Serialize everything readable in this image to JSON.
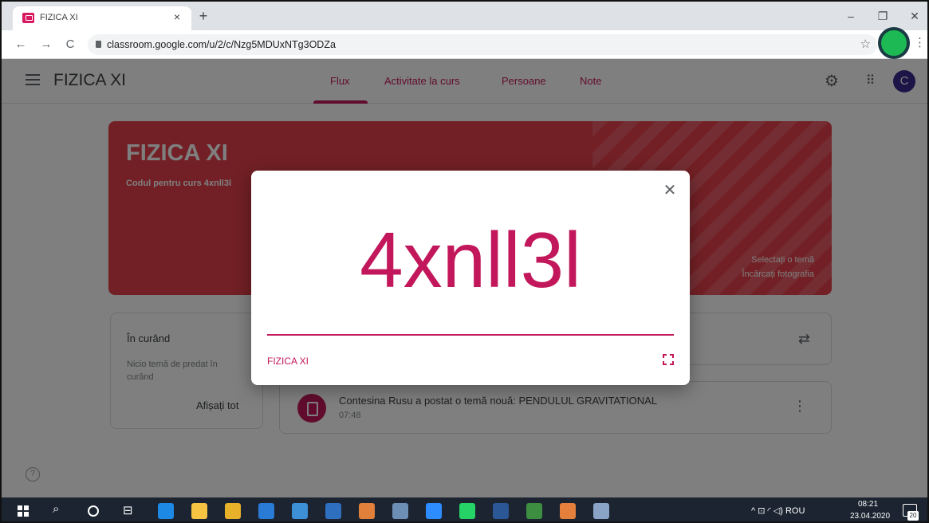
{
  "browser": {
    "tab_title": "FIZICA XI",
    "tab_close": "×",
    "new_tab": "+",
    "url": "classroom.google.com/u/2/c/Nzg5MDUxNTg3ODZa",
    "minimize": "–",
    "restore": "❐",
    "close": "✕",
    "back": "←",
    "forward": "→",
    "reload": "C",
    "star": "☆",
    "menu": "⋮"
  },
  "header": {
    "class_name": "FIZICA XI",
    "tabs": [
      {
        "label": "Flux"
      },
      {
        "label": "Activitate la curs"
      },
      {
        "label": "Persoane"
      },
      {
        "label": "Note"
      }
    ],
    "avatar_letter": "C",
    "gear": "⚙",
    "apps": "⠿"
  },
  "banner": {
    "title": "FIZICA XI",
    "class_code_label": "Codul pentru curs  4xnll3l",
    "select_theme": "Selectați o temă",
    "upload_photo": "Încărcați fotografia"
  },
  "upcoming": {
    "title": "În curând",
    "empty": "Nicio temă de predat în curând",
    "view_all": "Afișați tot"
  },
  "repost": "⇄",
  "post": {
    "text": "Contesina Rusu a postat o temă nouă: PENDULUL GRAVITATIONAL",
    "time": "07:48",
    "more": "⋮"
  },
  "help": "?",
  "modal": {
    "code": "4xnll3l",
    "class_name": "FIZICA XI",
    "close": "✕"
  },
  "taskbar": {
    "search": "⌕",
    "taskview": "⊟",
    "tray_text": "^  ⊡  ◜  ◁)  ROU",
    "time": "08:21",
    "date": "23.04.2020",
    "notification_count": "20"
  },
  "colors": {
    "accent": "#c2185b",
    "banner": "#e5414b",
    "profile": "#1db954"
  },
  "taskbar_icons": [
    {
      "name": "edge-icon",
      "color": "#1e88e5"
    },
    {
      "name": "file-explorer-icon",
      "color": "#f6c343"
    },
    {
      "name": "chrome-icon",
      "color": "#e8b12a"
    },
    {
      "name": "store-icon",
      "color": "#2a7bd5"
    },
    {
      "name": "media-icon",
      "color": "#3d8fd6"
    },
    {
      "name": "mail-icon",
      "color": "#2e6fbf"
    },
    {
      "name": "settings-app-icon",
      "color": "#e0803a"
    },
    {
      "name": "gallery-icon",
      "color": "#6d8fb5"
    },
    {
      "name": "zoom-icon",
      "color": "#2d8cff"
    },
    {
      "name": "whatsapp-icon",
      "color": "#25d366"
    },
    {
      "name": "word-icon",
      "color": "#2b5797"
    },
    {
      "name": "excel-icon",
      "color": "#3e8e41"
    },
    {
      "name": "paint-icon",
      "color": "#e57f3c"
    },
    {
      "name": "paint3d-icon",
      "color": "#8aa4c8"
    }
  ]
}
